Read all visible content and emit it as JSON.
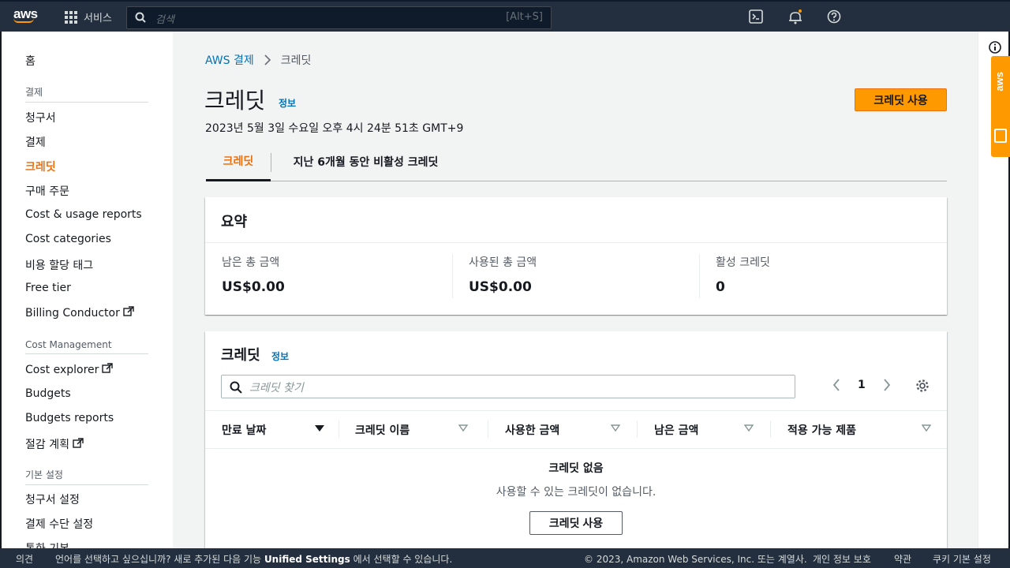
{
  "topnav": {
    "logo": "aws",
    "services_label": "서비스",
    "search_placeholder": "검색",
    "search_shortcut": "[Alt+S]"
  },
  "sidebar": {
    "home": "홈",
    "section_billing": "결제",
    "items_billing": [
      "청구서",
      "결제",
      "크레딧",
      "구매 주문",
      "Cost & usage reports",
      "Cost categories",
      "비용 할당 태그",
      "Free tier",
      "Billing Conductor"
    ],
    "section_cost": "Cost Management",
    "items_cost": [
      "Cost explorer",
      "Budgets",
      "Budgets reports",
      "절감 계획"
    ],
    "section_prefs": "기본 설정",
    "items_prefs": [
      "청구서 설정",
      "결제 수단 설정",
      "통화 기본"
    ]
  },
  "breadcrumb": {
    "parent": "AWS 결제",
    "current": "크레딧"
  },
  "header": {
    "title": "크레딧",
    "info": "정보",
    "datetime": "2023년 5월 3일 수요일 오후 4시 24분 51초 GMT+9",
    "primary_button": "크레딧 사용"
  },
  "tabs": [
    "크레딧",
    "지난 6개월 동안 비활성 크레딧"
  ],
  "summary": {
    "title": "요약",
    "items": [
      {
        "label": "남은 총 금액",
        "value": "US$0.00"
      },
      {
        "label": "사용된 총 금액",
        "value": "US$0.00"
      },
      {
        "label": "활성 크레딧",
        "value": "0"
      }
    ]
  },
  "credits_table": {
    "title": "크레딧",
    "info": "정보",
    "filter_placeholder": "크레딧 찾기",
    "page": "1",
    "columns": [
      "만료 날짜",
      "크레딧 이름",
      "사용한 금액",
      "남은 금액",
      "적용 가능 제품"
    ],
    "empty_title": "크레딧 없음",
    "empty_desc": "사용할 수 있는 크레딧이 없습니다.",
    "empty_button": "크레딧 사용"
  },
  "footer": {
    "feedback": "의견",
    "lang_text_1": "언어를 선택하고 싶으십니까? 새로 추가된 다음 기능",
    "lang_link": "Unified Settings",
    "lang_text_2": "에서 선택할 수 있습니다.",
    "copyright": "© 2023, Amazon Web Services, Inc. 또는 계열사.",
    "privacy": "개인 정보 보호",
    "terms": "약관",
    "cookies": "쿠키 기본 설정"
  },
  "colors": {
    "nav_bg": "#232f3e",
    "accent": "#ff9900",
    "active_text": "#ec7211",
    "link": "#0073bb"
  }
}
